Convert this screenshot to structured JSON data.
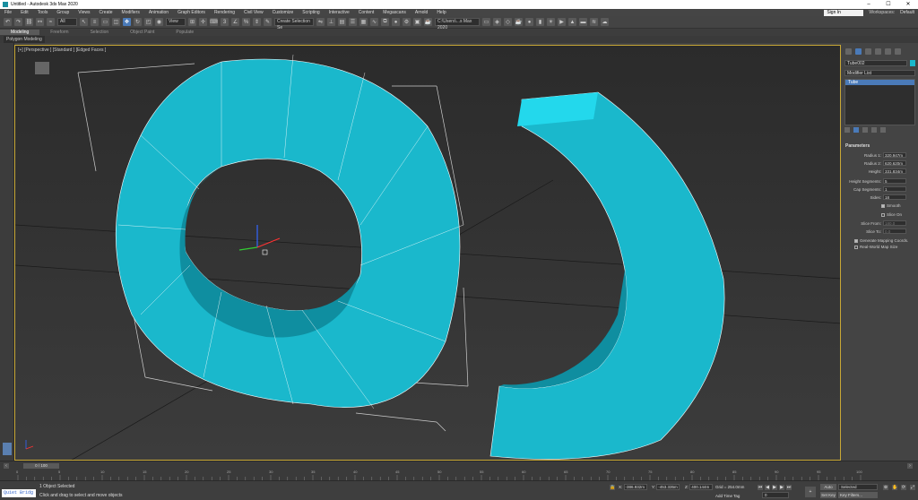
{
  "window": {
    "title": "Untitled - Autodesk 3ds Max 2020"
  },
  "menu": [
    "File",
    "Edit",
    "Tools",
    "Group",
    "Views",
    "Create",
    "Modifiers",
    "Animation",
    "Graph Editors",
    "Rendering",
    "Civil View",
    "Customize",
    "Scripting",
    "Interactive",
    "Content",
    "Megascans",
    "Arnold",
    "Help"
  ],
  "account": {
    "signin": "Sign In",
    "workspaces_label": "Workspaces:",
    "workspace": "Default"
  },
  "toolbar": {
    "filter": "All",
    "view": "View",
    "selection_set": "Create Selection Se",
    "path": "C:\\Users\\...s Max 2020"
  },
  "ribbon": {
    "tabs": [
      "Modeling",
      "Freeform",
      "Selection",
      "Object Paint",
      "Populate"
    ],
    "sub": "Polygon Modeling"
  },
  "viewport": {
    "label": "[+] [Perspective ] [Standard ] [Edged Faces ]"
  },
  "command_panel": {
    "object_name": "Tube002",
    "modifier_list": "Modifier List",
    "stack_item": "Tube",
    "rollout": "Parameters",
    "params": [
      {
        "label": "Radius 1:",
        "value": "320.947m"
      },
      {
        "label": "Radius 2:",
        "value": "620.620m"
      },
      {
        "label": "Height:",
        "value": "331.834m"
      },
      {
        "label": "Height Segments:",
        "value": "5"
      },
      {
        "label": "Cap Segments:",
        "value": "1"
      },
      {
        "label": "Sides:",
        "value": "18"
      }
    ],
    "smooth": "Smooth",
    "slice_on": "Slice On",
    "slice_from": "Slice From:",
    "slice_from_value": "180.0",
    "slice_to": "Slice To:",
    "slice_to_value": "0.0",
    "gen_mapping": "Generate Mapping Coords.",
    "real_world": "Real-World Map Size"
  },
  "timeline": {
    "slider": "0 / 100",
    "ticks": [
      "0",
      "5",
      "10",
      "15",
      "20",
      "25",
      "30",
      "35",
      "40",
      "45",
      "50",
      "55",
      "60",
      "65",
      "70",
      "75",
      "80",
      "85",
      "90",
      "95",
      "100"
    ]
  },
  "status": {
    "maxscript": "Quiet Bridg",
    "msg1": "1 Object Selected",
    "msg2": "Click and drag to select and move objects",
    "x_label": "X:",
    "x": "-386.932m",
    "y_label": "Y:",
    "y": "-453.335m",
    "z_label": "Z:",
    "z": "400.144m",
    "grid": "Grid = 254.0mm",
    "add_time_tag": "Add Time Tag",
    "auto_key": "Auto Key",
    "set_key": "Set Key",
    "selected": "Selected",
    "key_filters": "Key Filters...",
    "frame": "0"
  }
}
